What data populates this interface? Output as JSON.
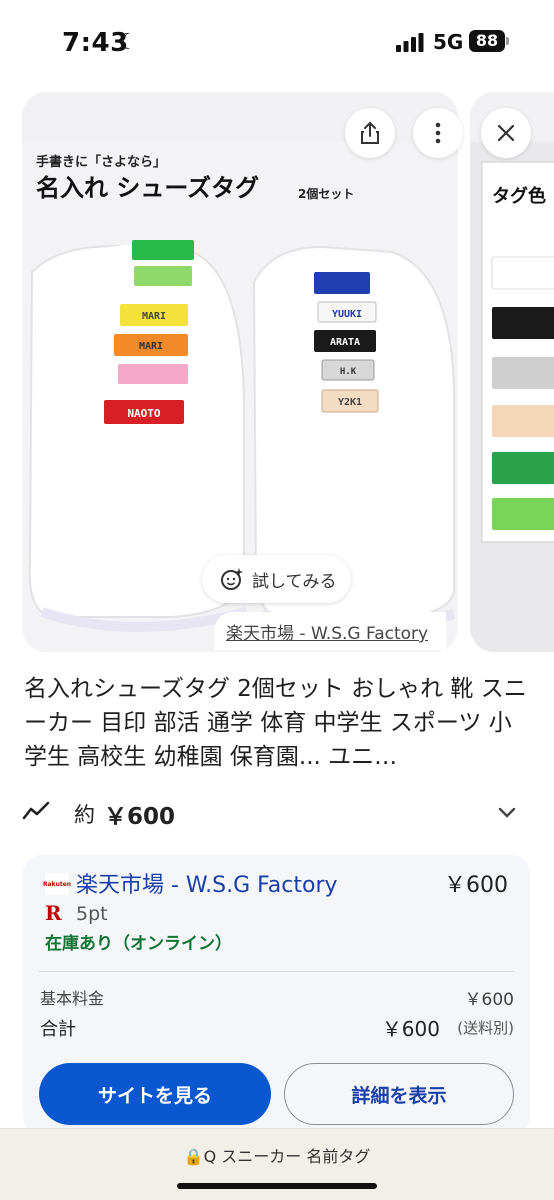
{
  "status_bar": {
    "time": "7:43",
    "network": "5G",
    "battery": "88"
  },
  "carousel": {
    "image_overlay": {
      "line1": "手書きに「さよなら」",
      "line2": "名入れ シューズタグ",
      "set_label": "2個セット",
      "left_tags": [
        "",
        "",
        "MARI",
        "MARI",
        "",
        "NAOTO"
      ],
      "right_tags": [
        "",
        "YUUKI",
        "ARATA",
        "H.K",
        "Y2K1"
      ],
      "next_image_title": "タグ色"
    },
    "try_on_label": "試してみる",
    "source_label": "楽天市場 - W.S.G Factory"
  },
  "product": {
    "title": "名入れシューズタグ 2個セット おしゃれ 靴 スニーカー 目印 部活 通学 体育 中学生 スポーツ 小学生 高校生 幼稚園 保育園... ユニ…",
    "price_prefix": "約",
    "price": "￥600"
  },
  "offer": {
    "seller_logo_text": "Rakuten",
    "seller": "楽天市場 - W.S.G Factory",
    "price": "￥600",
    "points_icon": "R",
    "points": "5pt",
    "stock": "在庫あり（オンライン）",
    "base_fee_label": "基本料金",
    "base_fee": "￥600",
    "total_label": "合計",
    "total": "￥600",
    "shipping_note": "(送料別)",
    "visit_button": "サイトを見る",
    "details_button": "詳細を表示"
  },
  "bottom_bar": {
    "query": "🔒Q スニーカー 名前タグ"
  },
  "colors": {
    "accent_blue": "#0b57d0",
    "link_blue": "#1a3fa8",
    "stock_green": "#137333",
    "rakuten_red": "#bf0000"
  }
}
